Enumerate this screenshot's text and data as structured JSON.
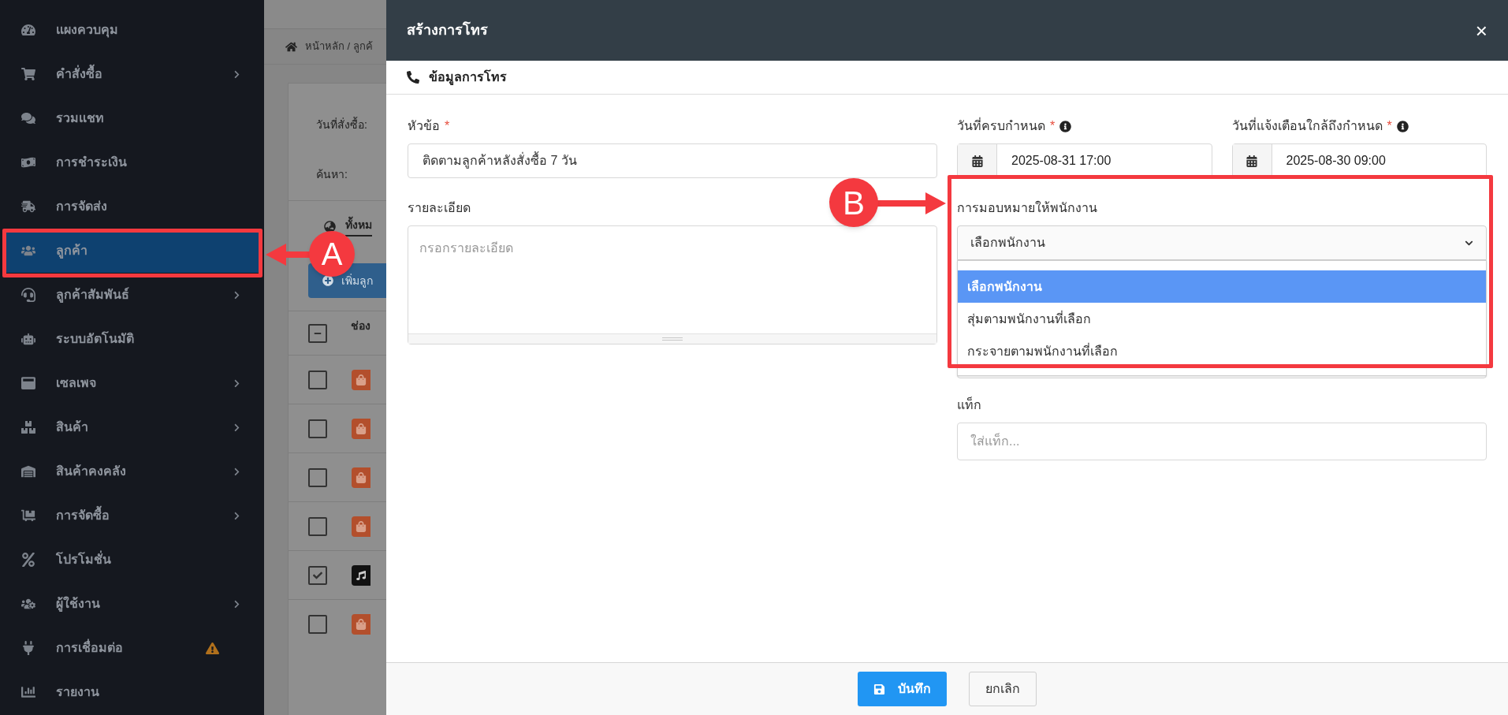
{
  "sidebar": {
    "items": [
      {
        "label": "แผงควบคุม",
        "has_submenu": false,
        "selected": false,
        "alert": false
      },
      {
        "label": "คำสั่งซื้อ",
        "has_submenu": true,
        "selected": false,
        "alert": false
      },
      {
        "label": "รวมแชท",
        "has_submenu": false,
        "selected": false,
        "alert": false
      },
      {
        "label": "การชำระเงิน",
        "has_submenu": false,
        "selected": false,
        "alert": false
      },
      {
        "label": "การจัดส่ง",
        "has_submenu": false,
        "selected": false,
        "alert": false
      },
      {
        "label": "ลูกค้า",
        "has_submenu": false,
        "selected": true,
        "alert": false
      },
      {
        "label": "ลูกค้าสัมพันธ์",
        "has_submenu": true,
        "selected": false,
        "alert": false
      },
      {
        "label": "ระบบอัตโนมัติ",
        "has_submenu": false,
        "selected": false,
        "alert": false
      },
      {
        "label": "เซลเพจ",
        "has_submenu": true,
        "selected": false,
        "alert": false
      },
      {
        "label": "สินค้า",
        "has_submenu": true,
        "selected": false,
        "alert": false
      },
      {
        "label": "สินค้าคงคลัง",
        "has_submenu": true,
        "selected": false,
        "alert": false
      },
      {
        "label": "การจัดซื้อ",
        "has_submenu": true,
        "selected": false,
        "alert": false
      },
      {
        "label": "โปรโมชั่น",
        "has_submenu": false,
        "selected": false,
        "alert": false
      },
      {
        "label": "ผู้ใช้งาน",
        "has_submenu": true,
        "selected": false,
        "alert": false
      },
      {
        "label": "การเชื่อมต่อ",
        "has_submenu": false,
        "selected": false,
        "alert": true
      },
      {
        "label": "รายงาน",
        "has_submenu": false,
        "selected": false,
        "alert": false
      }
    ]
  },
  "background_page": {
    "breadcrumb": "หน้าหลัก / ลูกค้",
    "filters": [
      "วันที่สั่งซื้อ:",
      "ค้นหา:"
    ],
    "tab": "ทั้งหม",
    "add_button": "เพิ่มลูก",
    "column_1": "ช่อง",
    "header_checkbox_partial": true,
    "rows": [
      {
        "checked": false,
        "kind": "bag"
      },
      {
        "checked": false,
        "kind": "bag"
      },
      {
        "checked": false,
        "kind": "bag"
      },
      {
        "checked": false,
        "kind": "bag"
      },
      {
        "checked": true,
        "kind": "note"
      },
      {
        "checked": false,
        "kind": "bag"
      }
    ]
  },
  "modal": {
    "title": "สร้างการโทร",
    "close": "×",
    "section": "ข้อมูลการโทร",
    "subject": {
      "label": "หัวข้อ",
      "required_mark": "*",
      "value": "ติดตามลูกค้าหลังสั่งซื้อ 7 วัน"
    },
    "details": {
      "label": "รายละเอียด",
      "placeholder": "กรอกรายละเอียด"
    },
    "due_date": {
      "label": "วันที่ครบกำหนด",
      "required_mark": "*",
      "value": "2025-08-31 17:00"
    },
    "reminder_date": {
      "label": "วันที่แจ้งเตือนใกล้ถึงกำหนด",
      "required_mark": "*",
      "value": "2025-08-30 09:00"
    },
    "assign": {
      "label": "การมอบหมายให้พนักงาน",
      "value": "เลือกพนักงาน",
      "expanded": true,
      "options": [
        {
          "label": "เลือกพนักงาน",
          "selected": true
        },
        {
          "label": "สุ่มตามพนักงานที่เลือก",
          "selected": false
        },
        {
          "label": "กระจายตามพนักงานที่เลือก",
          "selected": false
        }
      ]
    },
    "tags": {
      "label": "แท็ก",
      "placeholder": "ใส่แท็ก..."
    },
    "buttons": [
      {
        "label": "บันทึก",
        "kind": "primary"
      },
      {
        "label": "ยกเลิก",
        "kind": "secondary"
      }
    ]
  },
  "annotations": [
    {
      "letter": "A"
    },
    {
      "letter": "B"
    }
  ]
}
